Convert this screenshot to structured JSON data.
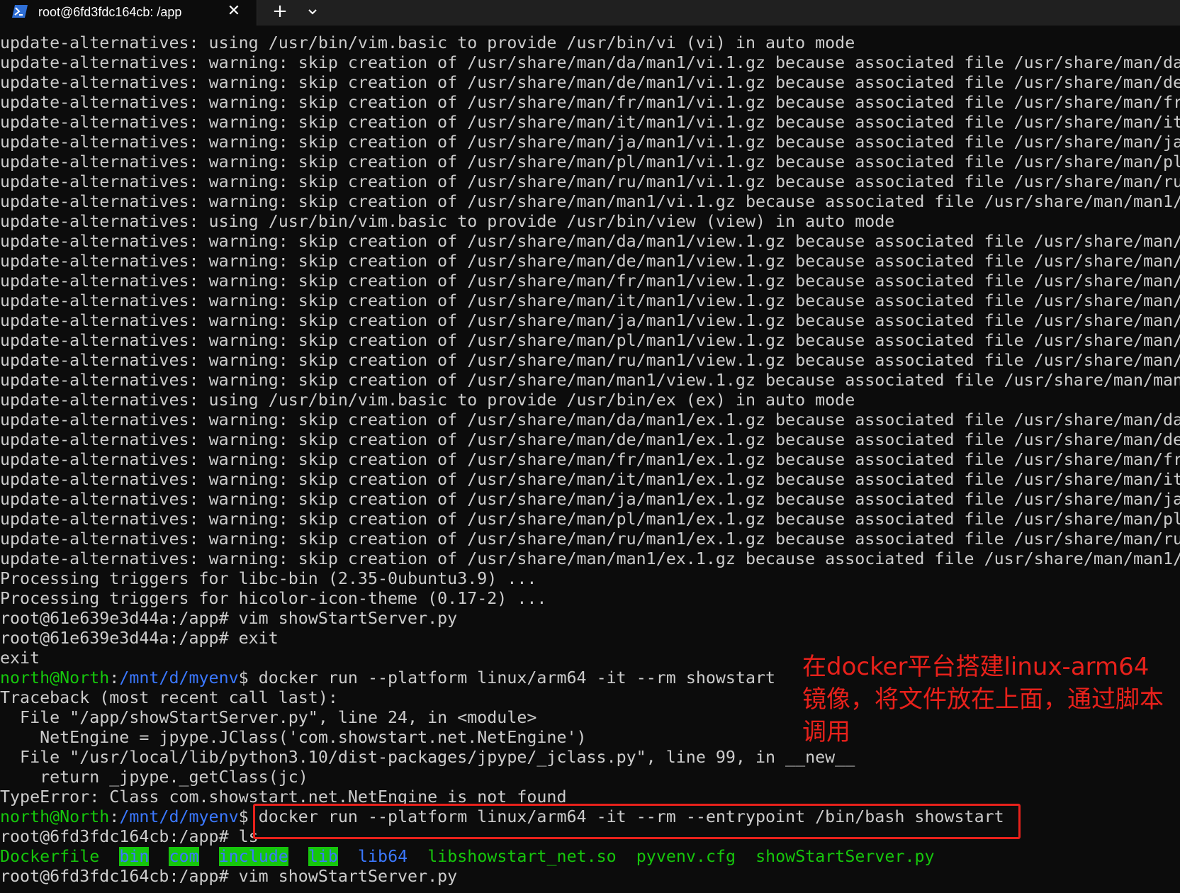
{
  "tab": {
    "title": "root@6fd3fdc164cb: /app",
    "close_glyph": "✕",
    "new_tab_glyph": "+",
    "icon": "powershell-terminal-icon",
    "dropdown_icon": "chevron-down-icon"
  },
  "terminal": {
    "plain_lines": [
      "update-alternatives: using /usr/bin/vim.basic to provide /usr/bin/vi (vi) in auto mode",
      "update-alternatives: warning: skip creation of /usr/share/man/da/man1/vi.1.gz because associated file /usr/share/man/da",
      "update-alternatives: warning: skip creation of /usr/share/man/de/man1/vi.1.gz because associated file /usr/share/man/de",
      "update-alternatives: warning: skip creation of /usr/share/man/fr/man1/vi.1.gz because associated file /usr/share/man/fr",
      "update-alternatives: warning: skip creation of /usr/share/man/it/man1/vi.1.gz because associated file /usr/share/man/it",
      "update-alternatives: warning: skip creation of /usr/share/man/ja/man1/vi.1.gz because associated file /usr/share/man/ja",
      "update-alternatives: warning: skip creation of /usr/share/man/pl/man1/vi.1.gz because associated file /usr/share/man/pl",
      "update-alternatives: warning: skip creation of /usr/share/man/ru/man1/vi.1.gz because associated file /usr/share/man/ru",
      "update-alternatives: warning: skip creation of /usr/share/man/man1/vi.1.gz because associated file /usr/share/man/man1/",
      "update-alternatives: using /usr/bin/vim.basic to provide /usr/bin/view (view) in auto mode",
      "update-alternatives: warning: skip creation of /usr/share/man/da/man1/view.1.gz because associated file /usr/share/man/",
      "update-alternatives: warning: skip creation of /usr/share/man/de/man1/view.1.gz because associated file /usr/share/man/",
      "update-alternatives: warning: skip creation of /usr/share/man/fr/man1/view.1.gz because associated file /usr/share/man/",
      "update-alternatives: warning: skip creation of /usr/share/man/it/man1/view.1.gz because associated file /usr/share/man/",
      "update-alternatives: warning: skip creation of /usr/share/man/ja/man1/view.1.gz because associated file /usr/share/man/",
      "update-alternatives: warning: skip creation of /usr/share/man/pl/man1/view.1.gz because associated file /usr/share/man/",
      "update-alternatives: warning: skip creation of /usr/share/man/ru/man1/view.1.gz because associated file /usr/share/man/",
      "update-alternatives: warning: skip creation of /usr/share/man/man1/view.1.gz because associated file /usr/share/man/man",
      "update-alternatives: using /usr/bin/vim.basic to provide /usr/bin/ex (ex) in auto mode",
      "update-alternatives: warning: skip creation of /usr/share/man/da/man1/ex.1.gz because associated file /usr/share/man/da",
      "update-alternatives: warning: skip creation of /usr/share/man/de/man1/ex.1.gz because associated file /usr/share/man/de",
      "update-alternatives: warning: skip creation of /usr/share/man/fr/man1/ex.1.gz because associated file /usr/share/man/fr",
      "update-alternatives: warning: skip creation of /usr/share/man/it/man1/ex.1.gz because associated file /usr/share/man/it",
      "update-alternatives: warning: skip creation of /usr/share/man/ja/man1/ex.1.gz because associated file /usr/share/man/ja",
      "update-alternatives: warning: skip creation of /usr/share/man/pl/man1/ex.1.gz because associated file /usr/share/man/pl",
      "update-alternatives: warning: skip creation of /usr/share/man/ru/man1/ex.1.gz because associated file /usr/share/man/ru",
      "update-alternatives: warning: skip creation of /usr/share/man/man1/ex.1.gz because associated file /usr/share/man/man1/",
      "Processing triggers for libc-bin (2.35-0ubuntu3.9) ...",
      "Processing triggers for hicolor-icon-theme (0.17-2) ...",
      "root@61e639e3d44a:/app# vim showStartServer.py",
      "root@61e639e3d44a:/app# exit",
      "exit"
    ],
    "prompt1": {
      "user_host": "north@North",
      "sep": ":",
      "path": "/mnt/d/myenv",
      "dollar": "$ ",
      "command": "docker run --platform linux/arm64 -it --rm showstart"
    },
    "traceback_lines": [
      "Traceback (most recent call last):",
      "  File \"/app/showStartServer.py\", line 24, in <module>",
      "    NetEngine = jpype.JClass('com.showstart.net.NetEngine')",
      "  File \"/usr/local/lib/python3.10/dist-packages/jpype/_jclass.py\", line 99, in __new__",
      "    return _jpype._getClass(jc)",
      "TypeError: Class com.showstart.net.NetEngine is not found"
    ],
    "prompt2": {
      "user_host": "north@North",
      "sep": ":",
      "path": "/mnt/d/myenv",
      "dollar": "$ ",
      "command": "docker run --platform linux/arm64 -it --rm --entrypoint /bin/bash showstart"
    },
    "ls_prompt": "root@6fd3fdc164cb:/app# ls",
    "ls_entries": {
      "dockerfile": "Dockerfile",
      "bin": "bin",
      "com": "com",
      "include": "include",
      "lib": "lib",
      "lib64": "lib64",
      "so": "libshowstart_net.so",
      "cfg": "pyvenv.cfg",
      "py": "showStartServer.py"
    },
    "last_line": "root@6fd3fdc164cb:/app# vim showStartServer.py"
  },
  "annotation": {
    "text": "在docker平台搭建linux-arm64镜像，将文件放在上面，通过脚本调用",
    "color": "#e8211b"
  },
  "colors": {
    "background": "#0c0c0c",
    "foreground": "#cccccc",
    "green": "#16c60c",
    "blue": "#3b78ff",
    "annotation_red": "#e8211b"
  }
}
